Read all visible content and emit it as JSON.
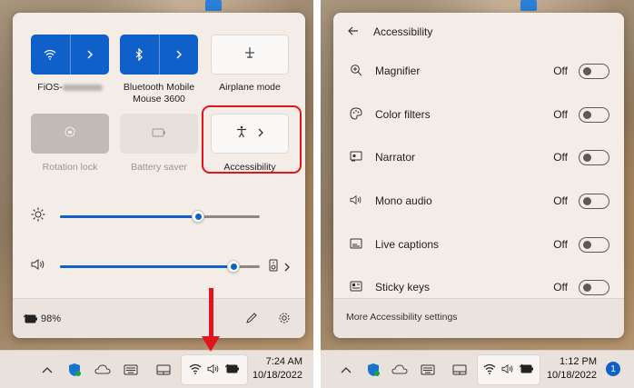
{
  "quick_settings": {
    "tiles": [
      {
        "label": "FiOS-",
        "state": "on"
      },
      {
        "label": "Bluetooth Mobile Mouse 3600",
        "state": "on"
      },
      {
        "label": "Airplane mode",
        "state": "off"
      },
      {
        "label": "Rotation lock",
        "state": "disabled"
      },
      {
        "label": "Battery saver",
        "state": "disabled"
      },
      {
        "label": "Accessibility",
        "state": "off"
      }
    ],
    "brightness_level": 0.69,
    "volume_level": 0.87,
    "battery_text": "98%"
  },
  "accessibility": {
    "title": "Accessibility",
    "items": [
      {
        "label": "Magnifier",
        "state": "Off"
      },
      {
        "label": "Color filters",
        "state": "Off"
      },
      {
        "label": "Narrator",
        "state": "Off"
      },
      {
        "label": "Mono audio",
        "state": "Off"
      },
      {
        "label": "Live captions",
        "state": "Off"
      },
      {
        "label": "Sticky keys",
        "state": "Off"
      }
    ],
    "footer_link": "More Accessibility settings"
  },
  "taskbar_left": {
    "time": "7:24 AM",
    "date": "10/18/2022"
  },
  "taskbar_right": {
    "time": "1:12 PM",
    "date": "10/18/2022",
    "notification_count": "1"
  },
  "colors": {
    "accent": "#0f61c9",
    "highlight": "#e0161b"
  }
}
